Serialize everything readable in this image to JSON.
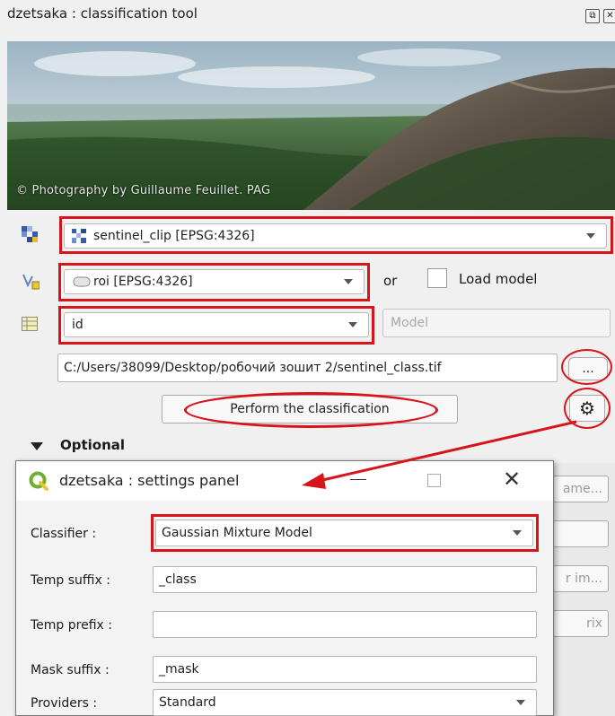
{
  "panel": {
    "title": "dzetsaka : classification tool",
    "photo_credit": "© Photography by Guillaume Feuillet. PAG"
  },
  "inputs": {
    "raster": "sentinel_clip [EPSG:4326]",
    "vector": "roi [EPSG:4326]",
    "or_label": "or",
    "load_model_label": "Load model",
    "field": "id",
    "model_placeholder": "Model",
    "output_path": "C:/Users/38099/Desktop/робочий зошит 2/sentinel_class.tif",
    "browse_label": "...",
    "perform_label": "Perform the classification",
    "optional_label": "Optional"
  },
  "right_truncated": {
    "b1": "ame...",
    "b2": "r im...",
    "b3": "rix"
  },
  "settings": {
    "title": "dzetsaka : settings panel",
    "classifier_label": "Classifier :",
    "classifier_value": "Gaussian Mixture Model",
    "temp_suffix_label": "Temp suffix :",
    "temp_suffix_value": "_class",
    "temp_prefix_label": "Temp prefix :",
    "temp_prefix_value": "",
    "mask_suffix_label": "Mask suffix :",
    "mask_suffix_value": "_mask",
    "providers_label": "Providers :",
    "providers_value": "Standard"
  },
  "colors": {
    "highlight": "#d8141b",
    "qgis_green": "#6fae2f"
  }
}
